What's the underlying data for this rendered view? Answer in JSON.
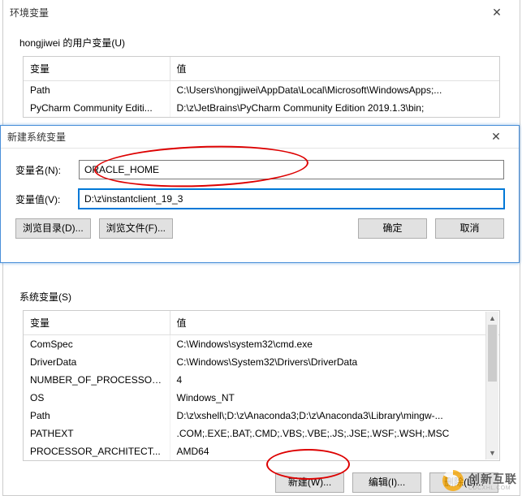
{
  "main": {
    "title": "环境变量",
    "user_vars_label": "hongjiwei 的用户变量(U)",
    "system_vars_label": "系统变量(S)",
    "headers": {
      "name": "变量",
      "value": "值"
    },
    "user_rows": [
      {
        "name": "Path",
        "value": "C:\\Users\\hongjiwei\\AppData\\Local\\Microsoft\\WindowsApps;..."
      },
      {
        "name": "PyCharm Community Editi...",
        "value": "D:\\z\\JetBrains\\PyCharm Community Edition 2019.1.3\\bin;"
      }
    ],
    "sys_rows": [
      {
        "name": "ComSpec",
        "value": "C:\\Windows\\system32\\cmd.exe"
      },
      {
        "name": "DriverData",
        "value": "C:\\Windows\\System32\\Drivers\\DriverData"
      },
      {
        "name": "NUMBER_OF_PROCESSORS",
        "value": "4"
      },
      {
        "name": "OS",
        "value": "Windows_NT"
      },
      {
        "name": "Path",
        "value": "D:\\z\\xshell\\;D:\\z\\Anaconda3;D:\\z\\Anaconda3\\Library\\mingw-..."
      },
      {
        "name": "PATHEXT",
        "value": ".COM;.EXE;.BAT;.CMD;.VBS;.VBE;.JS;.JSE;.WSF;.WSH;.MSC"
      },
      {
        "name": "PROCESSOR_ARCHITECT...",
        "value": "AMD64"
      }
    ],
    "buttons": {
      "new": "新建(W)...",
      "edit": "编辑(I)...",
      "delete": "删除(L)..."
    }
  },
  "dlg": {
    "title": "新建系统变量",
    "name_label": "变量名(N):",
    "name_value": "ORACLE_HOME",
    "value_label": "变量值(V):",
    "value_value": "D:\\z\\instantclient_19_3",
    "browse_dir": "浏览目录(D)...",
    "browse_file": "浏览文件(F)...",
    "ok": "确定",
    "cancel": "取消"
  },
  "watermark": {
    "brand_cn": "创新互联",
    "brand_en": "CDCXHL.COM"
  }
}
